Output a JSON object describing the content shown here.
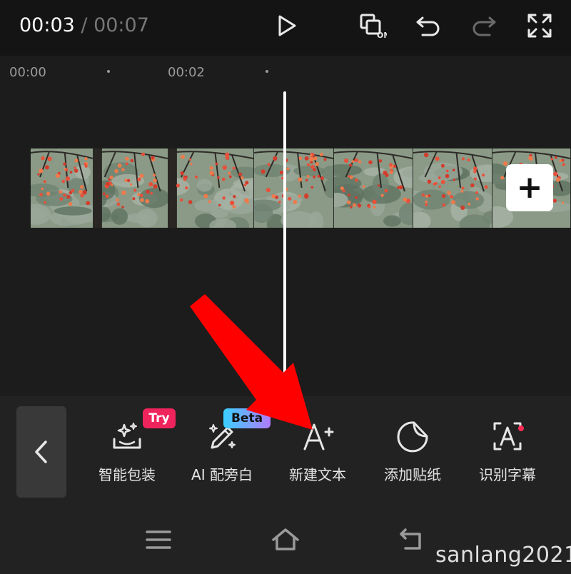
{
  "player": {
    "current_time": "00:03",
    "separator": " / ",
    "total_time": "00:07"
  },
  "top_icons": [
    "play-icon",
    "proxy-on-icon",
    "undo-icon",
    "redo-icon",
    "fullscreen-icon"
  ],
  "proxy_label": "ON",
  "ruler": {
    "labels": [
      "00:00",
      "00:02"
    ]
  },
  "timeline": {
    "add_clip_icon": "plus-icon",
    "add_clip_label": "+"
  },
  "toolbar": {
    "back_icon": "chevron-left-icon",
    "tools": [
      {
        "label": "智能包装",
        "icon": "sparkle-tray-icon",
        "badge": "Try"
      },
      {
        "label": "AI 配旁白",
        "icon": "magic-pen-icon",
        "badge": "Beta"
      },
      {
        "label": "新建文本",
        "icon": "add-text-icon"
      },
      {
        "label": "添加贴纸",
        "icon": "sticker-icon"
      },
      {
        "label": "识别字幕",
        "icon": "caption-recognize-icon"
      }
    ]
  },
  "navbar": {
    "icons": [
      "menu-icon",
      "home-icon",
      "back-icon"
    ]
  },
  "watermark": "sanlang2021",
  "colors": {
    "background": "#151515",
    "toolbar": "#222222",
    "badge_try": "#f0245d",
    "badge_beta": "#3ad0ff",
    "annotation_arrow": "#ff0000"
  }
}
